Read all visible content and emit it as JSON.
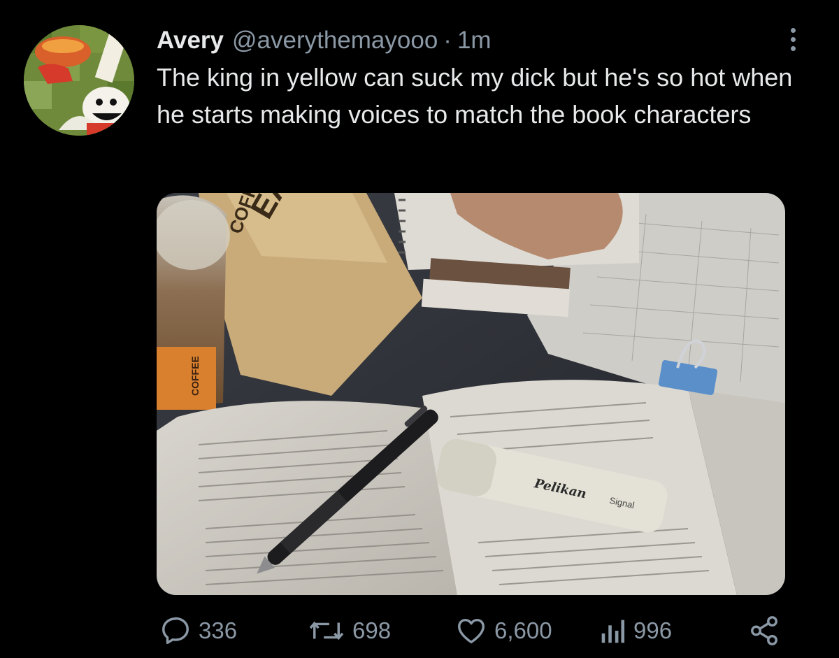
{
  "user": {
    "name": "Avery",
    "handle": "@averythemayooo",
    "separator": "·",
    "time": "1m"
  },
  "tweet": {
    "text": "The king in yellow can suck my dick but he's so hot when he starts making voices to match the book characters"
  },
  "photo_text": {
    "bag_label": "COFFEE",
    "bag_big": "EA",
    "cup_label": "COFFEE",
    "highlighter_brand": "Pelikan",
    "highlighter_model": "Signal"
  },
  "metrics": {
    "replies": "336",
    "retweets": "698",
    "likes": "6,600",
    "views": "996"
  },
  "icons": {
    "more": "more-vertical-icon",
    "reply": "reply-icon",
    "retweet": "retweet-icon",
    "like": "heart-icon",
    "views": "views-icon",
    "share": "share-icon"
  },
  "colors": {
    "background": "#000000",
    "text": "#e7e9ea",
    "muted": "#8b98a5"
  }
}
